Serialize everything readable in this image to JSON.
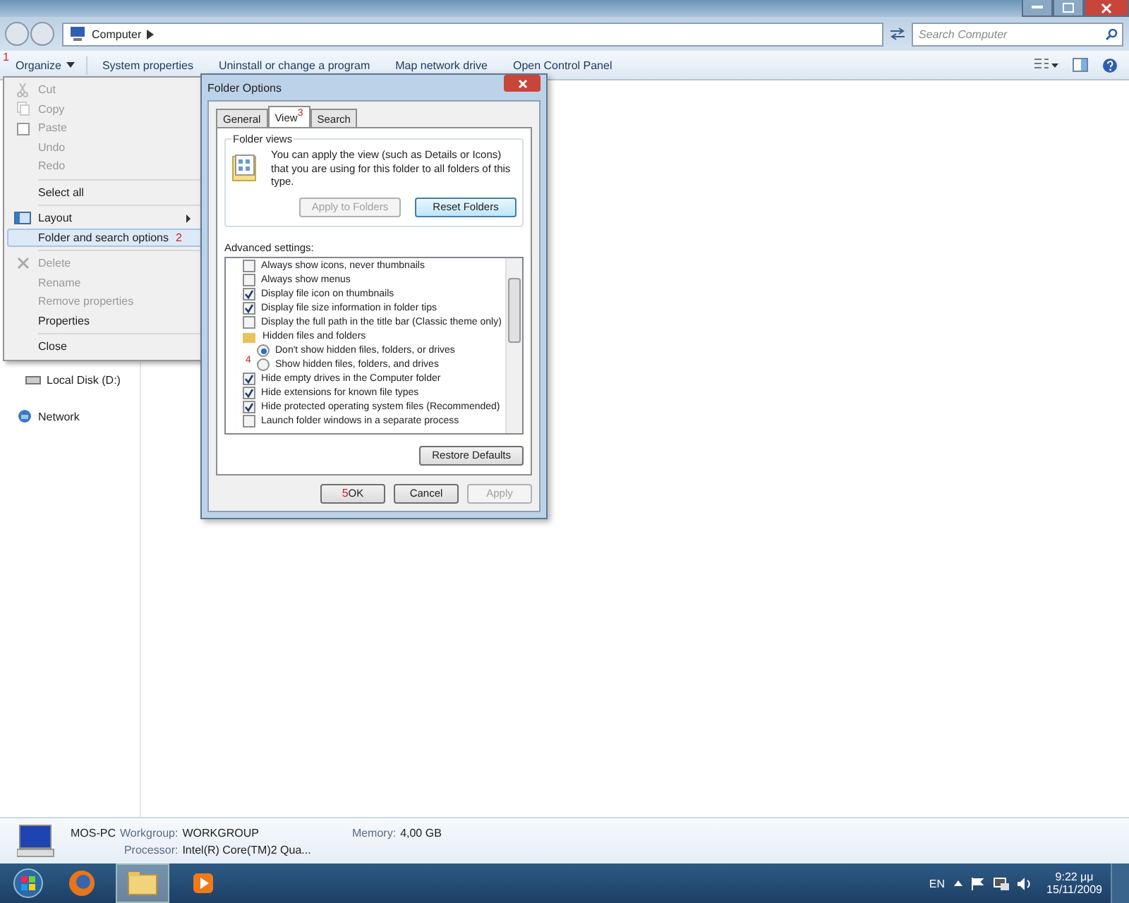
{
  "address_bar": {
    "crumbs": [
      "Computer"
    ],
    "search_placeholder": "Search Computer"
  },
  "toolbar": {
    "annotation": "1",
    "buttons": [
      "Organize",
      "System properties",
      "Uninstall or change a program",
      "Map network drive",
      "Open Control Panel"
    ]
  },
  "organize_menu": {
    "groups": [
      [
        {
          "label": "Cut",
          "disabled": true,
          "selected": false
        },
        {
          "label": "Copy",
          "disabled": true,
          "selected": false
        },
        {
          "label": "Paste",
          "disabled": true,
          "selected": false
        },
        {
          "label": "Undo",
          "disabled": true,
          "selected": false
        },
        {
          "label": "Redo",
          "disabled": true,
          "selected": false
        }
      ],
      [
        {
          "label": "Select all",
          "disabled": false,
          "selected": false
        }
      ],
      [
        {
          "label": "Layout",
          "disabled": false,
          "selected": false,
          "submenu": true
        },
        {
          "label": "Folder and search options",
          "disabled": false,
          "selected": true,
          "annotation": "2"
        }
      ],
      [
        {
          "label": "Delete",
          "disabled": true,
          "selected": false
        },
        {
          "label": "Rename",
          "disabled": true,
          "selected": false
        },
        {
          "label": "Remove properties",
          "disabled": true,
          "selected": false
        },
        {
          "label": "Properties",
          "disabled": false,
          "selected": false
        }
      ],
      [
        {
          "label": "Close",
          "disabled": false,
          "selected": false
        }
      ]
    ]
  },
  "sidebar": {
    "items": [
      "Local Disk (D:)",
      "Network"
    ]
  },
  "dialog": {
    "title": "Folder Options",
    "tabs": [
      {
        "label": "General",
        "selected": false
      },
      {
        "label": "View",
        "selected": true,
        "annotation": "3"
      },
      {
        "label": "Search",
        "selected": false
      }
    ],
    "folder_views": {
      "title": "Folder views",
      "text": "You can apply the view (such as Details or Icons) that you are using for this folder to all folders of this type.",
      "buttons": [
        {
          "label": "Apply to Folders",
          "disabled": true
        },
        {
          "label": "Reset Folders",
          "disabled": false
        }
      ]
    },
    "advanced_label": "Advanced settings:",
    "settings": [
      {
        "kind": "checkbox",
        "label": "Always show icons, never thumbnails",
        "checked": false
      },
      {
        "kind": "checkbox",
        "label": "Always show menus",
        "checked": false
      },
      {
        "kind": "checkbox",
        "label": "Display file icon on thumbnails",
        "checked": true
      },
      {
        "kind": "checkbox",
        "label": "Display file size information in folder tips",
        "checked": true
      },
      {
        "kind": "checkbox",
        "label": "Display the full path in the title bar (Classic theme only)",
        "checked": false
      },
      {
        "kind": "folder",
        "label": "Hidden files and folders"
      },
      {
        "kind": "radio",
        "label": "Don't show hidden files, folders, or drives",
        "selected": true,
        "annotation": "4"
      },
      {
        "kind": "radio",
        "label": "Show hidden files, folders, and drives",
        "selected": false
      },
      {
        "kind": "checkbox",
        "label": "Hide empty drives in the Computer folder",
        "checked": true
      },
      {
        "kind": "checkbox",
        "label": "Hide extensions for known file types",
        "checked": true
      },
      {
        "kind": "checkbox",
        "label": "Hide protected operating system files (Recommended)",
        "checked": true
      },
      {
        "kind": "checkbox",
        "label": "Launch folder windows in a separate process",
        "checked": false
      }
    ],
    "restore_button": "Restore Defaults",
    "buttons": [
      {
        "label": "OK",
        "disabled": false,
        "annotation": "5"
      },
      {
        "label": "Cancel",
        "disabled": false
      },
      {
        "label": "Apply",
        "disabled": true
      }
    ]
  },
  "details": {
    "name": "MOS-PC",
    "fields": [
      {
        "label": "Workgroup:",
        "value": "WORKGROUP"
      },
      {
        "label": "Memory:",
        "value": "4,00 GB"
      },
      {
        "label": "Processor:",
        "value": "Intel(R) Core(TM)2 Qua..."
      }
    ]
  },
  "taskbar": {
    "language": "EN",
    "time": "9:22 μμ",
    "date": "15/11/2009"
  }
}
